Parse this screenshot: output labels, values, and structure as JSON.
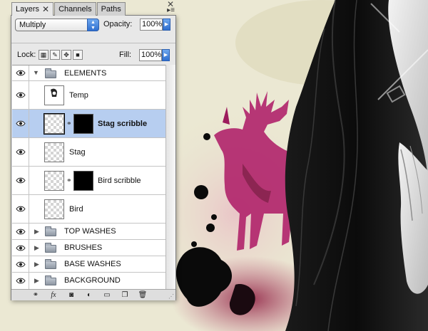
{
  "panel": {
    "tabs": [
      {
        "label": "Layers",
        "close": "✕",
        "active": true
      },
      {
        "label": "Channels",
        "active": false
      },
      {
        "label": "Paths",
        "active": false
      }
    ],
    "close_glyph": "✕",
    "menu_glyph": "≡",
    "blend_mode": "Multiply",
    "opacity_label": "Opacity:",
    "opacity_value": "100%",
    "lock_label": "Lock:",
    "fill_label": "Fill:",
    "fill_value": "100%"
  },
  "layers": [
    {
      "name": "ELEMENTS",
      "kind": "group",
      "expanded": true
    },
    {
      "name": "Temp",
      "kind": "layer"
    },
    {
      "name": "Stag scribble",
      "kind": "layer",
      "mask": true,
      "selected": true
    },
    {
      "name": "Stag",
      "kind": "layer"
    },
    {
      "name": "Bird scribble",
      "kind": "layer",
      "mask": true
    },
    {
      "name": "Bird",
      "kind": "layer"
    },
    {
      "name": "TOP WASHES",
      "kind": "group",
      "expanded": false
    },
    {
      "name": "BRUSHES",
      "kind": "group",
      "expanded": false
    },
    {
      "name": "BASE WASHES",
      "kind": "group",
      "expanded": false
    },
    {
      "name": "BACKGROUND",
      "kind": "group",
      "expanded": false
    }
  ],
  "bottom_icons": [
    "link-icon",
    "fx-icon",
    "mask-icon",
    "adjustment-icon",
    "new-group-icon",
    "new-layer-icon",
    "trash-icon"
  ],
  "colors": {
    "selection": "#b7cef0",
    "accent_blue": "#2f6fd0",
    "stag_magenta": "#b0226a"
  }
}
